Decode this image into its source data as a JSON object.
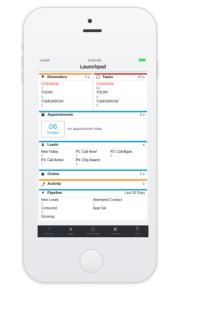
{
  "status_bar": {
    "carrier": "Carrier",
    "time": "10:00 AM"
  },
  "nav": {
    "title": "Launchpad"
  },
  "reminders": {
    "title": "Reminders",
    "count": "3",
    "overdue_label": "OVERDUE",
    "overdue_value": "3",
    "today_label": "TODAY",
    "today_value": "0",
    "tomorrow_label": "TOMORROW",
    "tomorrow_value": "0"
  },
  "tasks": {
    "title": "Tasks",
    "count": "42",
    "overdue_label": "OVERDUE",
    "overdue_value": "42",
    "today_label": "TODAY",
    "today_value": "0",
    "tomorrow_label": "TOMORROW",
    "tomorrow_value": "0"
  },
  "appointments": {
    "title": "Appointments",
    "count": "0",
    "day": "06",
    "month": "October",
    "empty_text": "No appointments today"
  },
  "leads": {
    "title": "Leads",
    "items": [
      {
        "label": "New Today",
        "value": "0"
      },
      {
        "label": "P1: Call Now!",
        "value": "2"
      },
      {
        "label": "P2: Call Again",
        "value": "0"
      },
      {
        "label": "P3: Call Active",
        "value": "1"
      },
      {
        "label": "P4: Chg Search",
        "value": "0"
      }
    ]
  },
  "online": {
    "title": "Online",
    "count": "0"
  },
  "activity": {
    "title": "Activity"
  },
  "pipeline": {
    "title": "Pipeline",
    "range": "Last 30 Days",
    "new_leads_label": "New Leads",
    "new_leads_value": "2",
    "attempted_label": "Attempted Contact",
    "attempted_value": "1",
    "contacted_label": "Contacted",
    "contacted_value": "0",
    "appt_set_label": "Appt Set",
    "showing_label": "Showing"
  },
  "tabs": [
    {
      "label": "Launchpad",
      "icon": "rocket-icon"
    },
    {
      "label": "Leads",
      "icon": "people-icon"
    },
    {
      "label": "Communication",
      "icon": "inbox-icon"
    },
    {
      "label": "Calendar",
      "icon": "calendar-icon"
    },
    {
      "label": "More",
      "icon": "menu-icon"
    }
  ],
  "colors": {
    "accent": "#1da1c8",
    "overdue": "#d9342b",
    "reminders_bar": "#f7941d",
    "tab_bar": "#2b2d32"
  }
}
